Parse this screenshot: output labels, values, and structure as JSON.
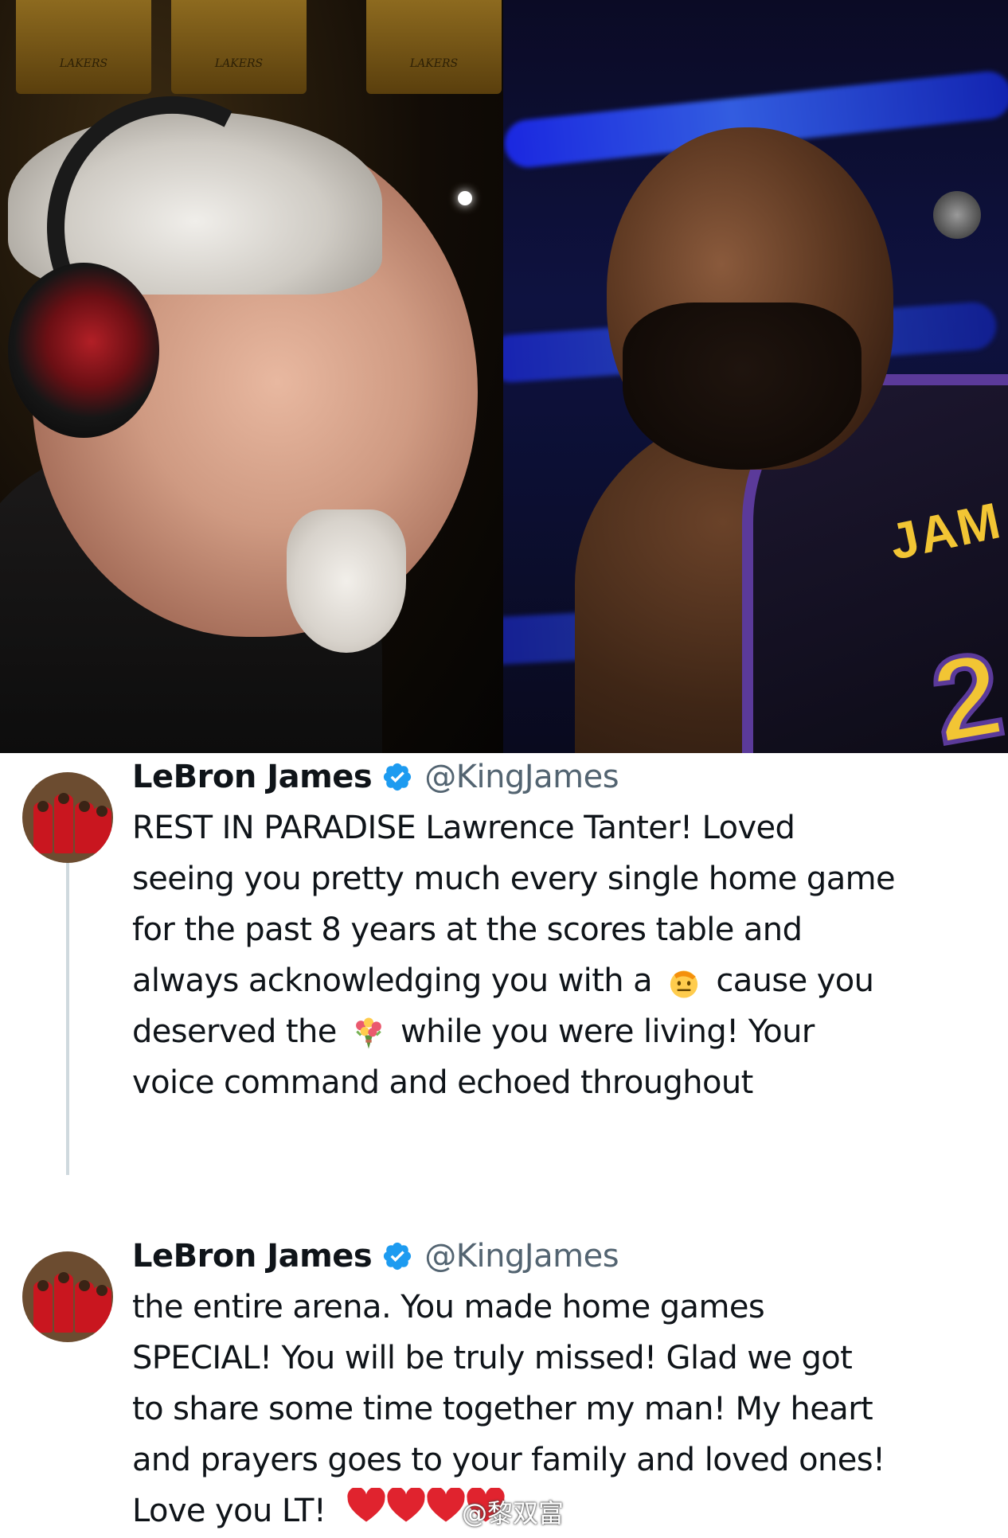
{
  "photos": {
    "left_banner_1": "LAKERS",
    "left_banner_2": "LAKERS",
    "jersey_letters": "JAM",
    "jersey_number": "2"
  },
  "tweets": [
    {
      "display_name": "LeBron James",
      "handle": "@KingJames",
      "lines": [
        "REST IN PARADISE Lawrence Tanter! Loved",
        "seeing you pretty much every single home game",
        "for the past 8 years at the scores table and",
        {
          "before": "always acknowledging you with a",
          "emoji": "saluting-face",
          "after": "cause you"
        },
        {
          "before": "deserved the",
          "emoji": "bouquet",
          "after": "while you were living! Your"
        },
        "voice command and echoed throughout"
      ]
    },
    {
      "display_name": "LeBron James",
      "handle": "@KingJames",
      "lines": [
        "the entire arena. You made home games",
        "SPECIAL!  You will be truly missed! Glad we got",
        "to share some time together my man! My heart",
        "and prayers goes to your family and loved ones!",
        {
          "before": "Love you LT!",
          "emoji": "red-heart-x4",
          "after": ""
        }
      ]
    }
  ],
  "watermark": "@黎双富",
  "colors": {
    "verified_blue": "#1d9bf0",
    "handle_gray": "#536471",
    "text": "#0f1419",
    "heart_red": "#e0232e",
    "thread_line": "#cfd9de"
  }
}
